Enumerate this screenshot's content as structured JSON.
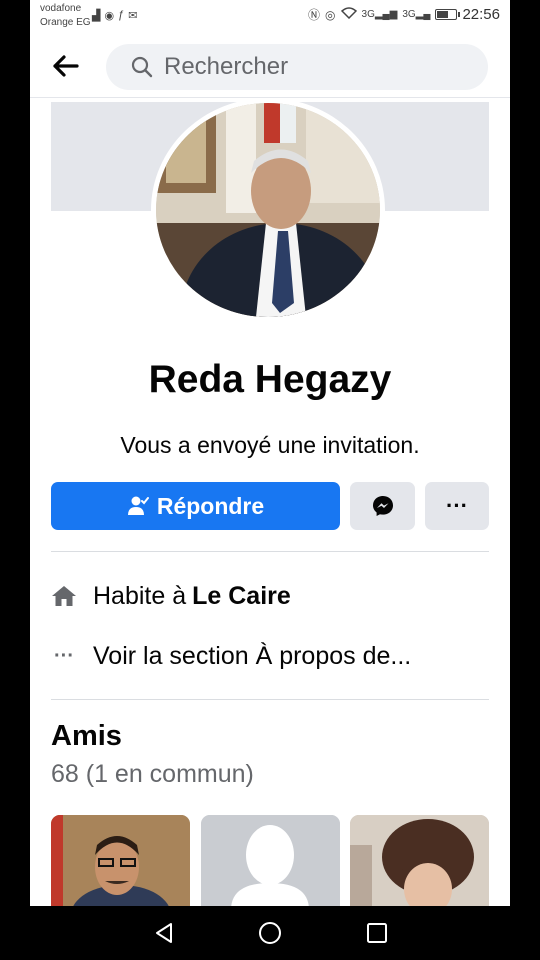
{
  "status_bar": {
    "carrier_1": "vodafone",
    "carrier_2": "Orange EG",
    "time": "22:56",
    "signal_1": "3G",
    "signal_2": "3G",
    "battery_level": 0.6
  },
  "search": {
    "placeholder": "Rechercher"
  },
  "profile": {
    "name": "Reda Hegazy",
    "invite_text": "Vous a envoyé une invitation."
  },
  "actions": {
    "respond_label": "Répondre",
    "more_label": "···"
  },
  "info": {
    "lives_prefix": "Habite à",
    "lives_city": "Le Caire",
    "about_dots": "···",
    "about_link": "Voir la section À propos de..."
  },
  "friends": {
    "title": "Amis",
    "count": "68 (1 en commun)"
  },
  "colors": {
    "brand_blue": "#1877f2",
    "button_gray": "#e4e6eb",
    "text_primary": "#050505",
    "text_secondary": "#65676b"
  }
}
